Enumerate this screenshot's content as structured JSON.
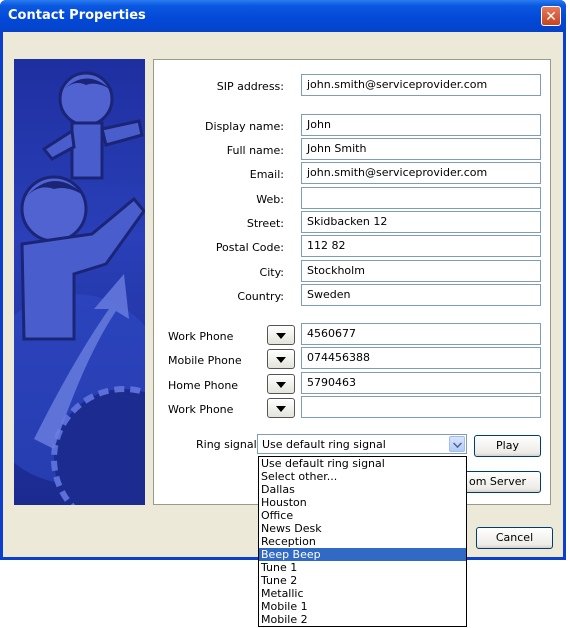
{
  "window": {
    "title": "Contact Properties",
    "close_glyph": "✕"
  },
  "form": {
    "sip": {
      "label": "SIP address:",
      "value": "john.smith@serviceprovider.com"
    },
    "fields": [
      {
        "label": "Display name:",
        "value": "John"
      },
      {
        "label": "Full name:",
        "value": "John Smith"
      },
      {
        "label": "Email:",
        "value": "john.smith@serviceprovider.com"
      },
      {
        "label": "Web:",
        "value": ""
      },
      {
        "label": "Street:",
        "value": "Skidbacken 12"
      },
      {
        "label": "Postal Code:",
        "value": "112 82"
      },
      {
        "label": "City:",
        "value": "Stockholm"
      },
      {
        "label": "Country:",
        "value": "Sweden"
      }
    ],
    "phones": [
      {
        "label": "Work Phone",
        "value": "4560677"
      },
      {
        "label": "Mobile Phone",
        "value": "074456388"
      },
      {
        "label": "Home Phone",
        "value": "5790463"
      },
      {
        "label": "Work Phone",
        "value": ""
      }
    ],
    "ring": {
      "label": "Ring signal:",
      "value": "Use default ring signal",
      "play_label": "Play"
    },
    "server_button_visible_text": "om Server"
  },
  "dropdown": {
    "items": [
      "Use default ring signal",
      "Select other...",
      "Dallas",
      "Houston",
      "Office",
      "News Desk",
      "Reception",
      "Beep Beep",
      "Tune 1",
      "Tune 2",
      "Metallic",
      "Mobile 1",
      "Mobile 2"
    ],
    "selected": "Beep Beep"
  },
  "footer": {
    "cancel_label": "Cancel"
  },
  "colors": {
    "title_bar": "#0a58e0",
    "selection": "#316ac5",
    "dialog_bg": "#ece9d8"
  },
  "icons": {
    "close": "close-icon",
    "dropdown": "chevron-down-icon"
  }
}
